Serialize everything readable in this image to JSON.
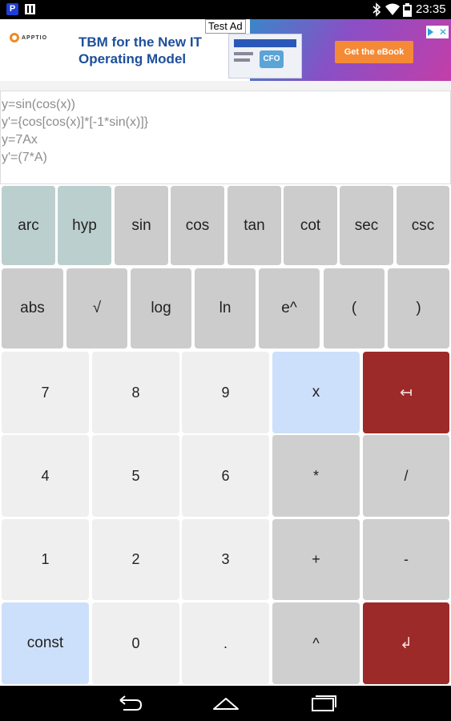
{
  "status_bar": {
    "time": "23:35"
  },
  "ad": {
    "badge": "Test Ad",
    "brand": "APPTIO",
    "headline": "TBM for the New IT Operating Model",
    "cta": "Get the eBook",
    "thumb_text": "CFO"
  },
  "display": {
    "lines": [
      "y=sin(cos(x))",
      "y'={cos[cos(x)]*[-1*sin(x)]}",
      "y=7Ax",
      "y'=(7*A)"
    ]
  },
  "keys": {
    "arc": "arc",
    "hyp": "hyp",
    "sin": "sin",
    "cos": "cos",
    "tan": "tan",
    "cot": "cot",
    "sec": "sec",
    "csc": "csc",
    "abs": "abs",
    "sqrt": "√",
    "log": "log",
    "ln": "ln",
    "exp": "e^",
    "lparen": "(",
    "rparen": ")",
    "d7": "7",
    "d8": "8",
    "d9": "9",
    "x": "x",
    "backspace": "↤",
    "d4": "4",
    "d5": "5",
    "d6": "6",
    "mul": "*",
    "div": "/",
    "d1": "1",
    "d2": "2",
    "d3": "3",
    "plus": "+",
    "minus": "-",
    "const": "const",
    "d0": "0",
    "dot": ".",
    "pow": "^",
    "enter": "↲"
  }
}
